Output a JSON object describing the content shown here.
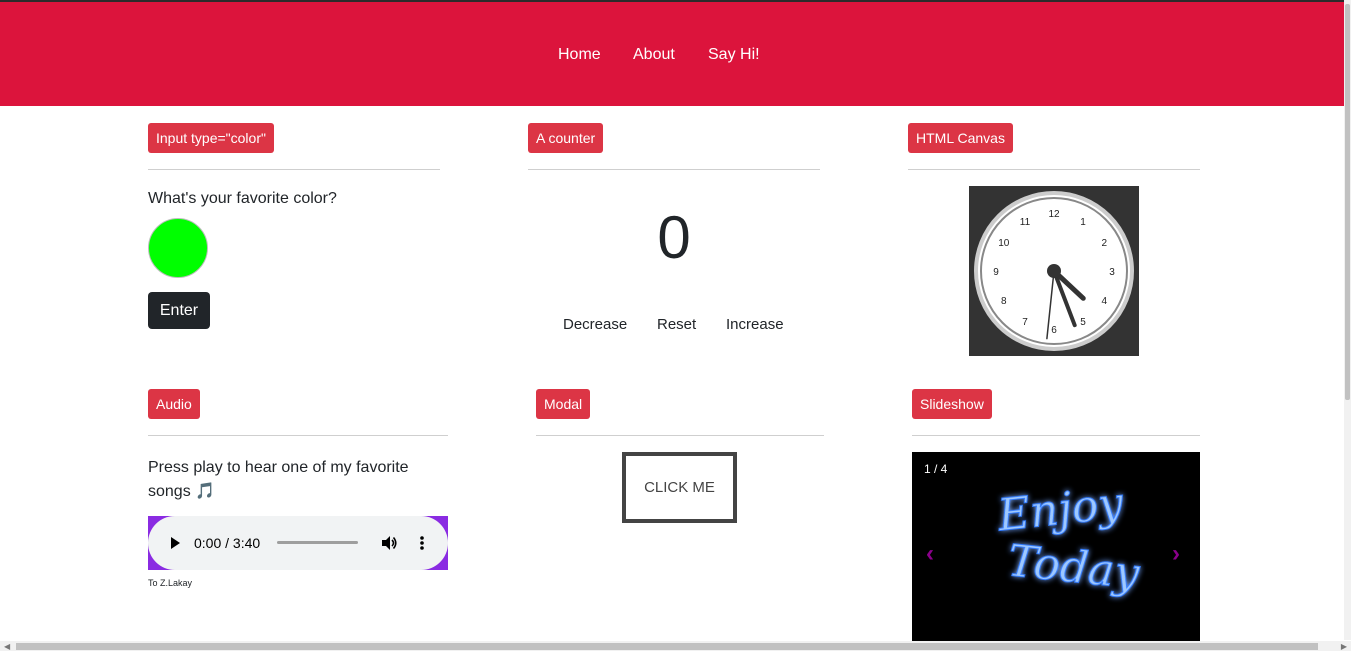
{
  "nav": {
    "items": [
      {
        "label": "Home"
      },
      {
        "label": "About"
      },
      {
        "label": "Say Hi!"
      }
    ]
  },
  "colorCard": {
    "badge": "Input type=\"color\"",
    "question": "What's your favorite color?",
    "value": "#00ff00",
    "button": "Enter"
  },
  "counterCard": {
    "badge": "A counter",
    "value": "0",
    "buttons": {
      "decrease": "Decrease",
      "reset": "Reset",
      "increase": "Increase"
    }
  },
  "canvasCard": {
    "badge": "HTML Canvas",
    "clock": {
      "numbers": [
        "12",
        "1",
        "2",
        "3",
        "4",
        "5",
        "6",
        "7",
        "8",
        "9",
        "10",
        "11"
      ],
      "hour": 4,
      "minute": 26,
      "second": 31
    }
  },
  "audioCard": {
    "badge": "Audio",
    "text": "Press play to hear one of my favorite songs 🎵",
    "time": "0:00 / 3:40",
    "caption": "To Z.Lakay"
  },
  "modalCard": {
    "badge": "Modal",
    "button": "CLICK ME"
  },
  "slideshowCard": {
    "badge": "Slideshow",
    "counter": "1 / 4",
    "slideText": [
      "Enjoy",
      "Today"
    ],
    "prev": "‹",
    "next": "›"
  },
  "colors": {
    "navbar": "#dc143c",
    "badge": "#dc3545",
    "accent": "#8a2be2"
  }
}
